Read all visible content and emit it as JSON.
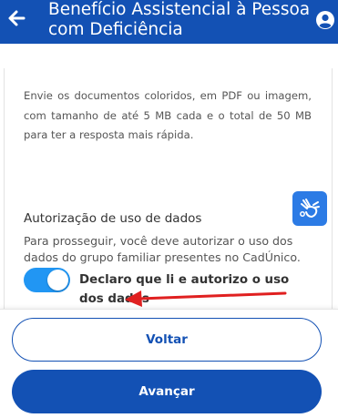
{
  "header": {
    "title": "Benefício Assistencial à Pessoa com Deficiência",
    "back_icon": "arrow-left-icon",
    "user_icon": "user-circle-icon",
    "background_color": "#1351b4"
  },
  "info": {
    "text": "Envie os documentos coloridos, em PDF ou imagem, com tamanho de até 5 MB cada e o total de 50 MB para ter a resposta mais rápida."
  },
  "accessibility": {
    "icon": "sign-language-icon",
    "color": "#2c7be5"
  },
  "authorization": {
    "title": "Autorização de uso de dados",
    "description": "Para prosseguir, você deve autorizar o uso dos dados do grupo familiar presentes no CadÚnico.",
    "toggle_on": true,
    "toggle_color": "#2196f3",
    "toggle_label": "Declaro que li e autorizo o uso dos dados"
  },
  "annotation": {
    "arrow_color": "#e02020"
  },
  "footer": {
    "back_label": "Voltar",
    "next_label": "Avançar"
  }
}
